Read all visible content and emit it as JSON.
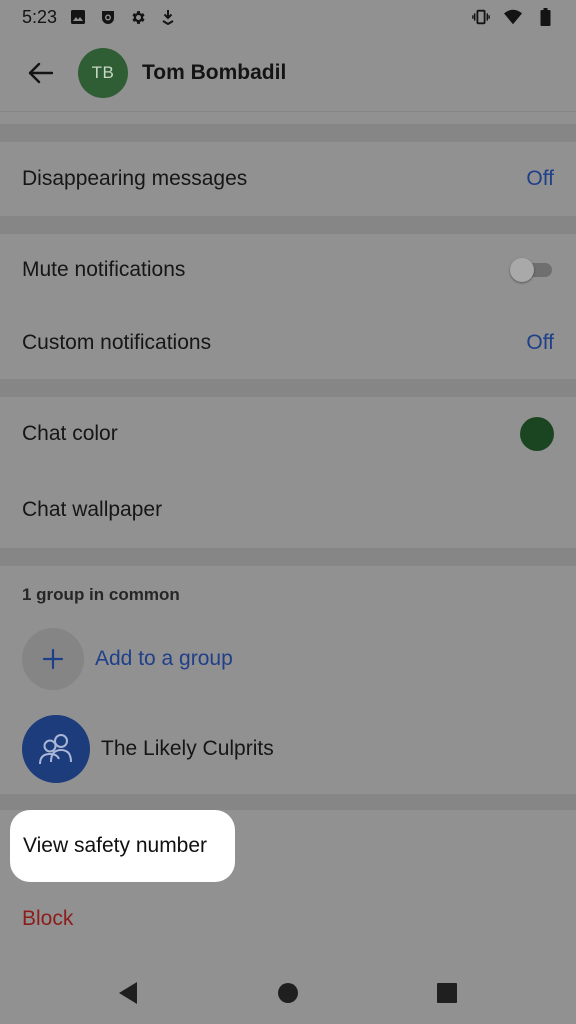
{
  "status_bar": {
    "time": "5:23",
    "icons_left": [
      "image-icon",
      "smile-badge-icon",
      "gear-icon",
      "download-icon"
    ],
    "icons_right": [
      "vibrate-icon",
      "wifi-icon",
      "battery-icon"
    ]
  },
  "header": {
    "avatar_initials": "TB",
    "contact_name": "Tom Bombadil"
  },
  "settings": {
    "disappearing_label": "Disappearing messages",
    "disappearing_value": "Off",
    "mute_label": "Mute notifications",
    "mute_on": false,
    "custom_label": "Custom notifications",
    "custom_value": "Off",
    "chat_color_label": "Chat color",
    "chat_color": "#1b4520",
    "wallpaper_label": "Chat wallpaper"
  },
  "groups": {
    "section_title": "1 group in common",
    "add_label": "Add to a group",
    "items": [
      {
        "name": "The Likely Culprits"
      }
    ]
  },
  "actions": {
    "safety_number_label": "View safety number",
    "block_label": "Block"
  },
  "colors": {
    "accent": "#1f3f8a",
    "danger": "#8b1e1a",
    "avatar_bg": "#2f5d34"
  }
}
